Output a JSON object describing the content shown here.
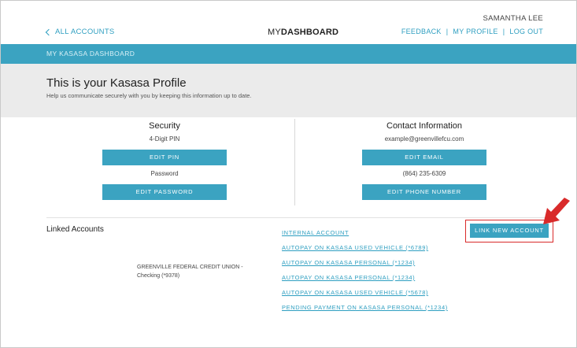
{
  "header": {
    "back_label": "ALL ACCOUNTS",
    "brand_light": "MY",
    "brand_bold": "DASHBOARD",
    "user_name": "SAMANTHA LEE",
    "links": [
      "FEEDBACK",
      "MY PROFILE",
      "LOG OUT"
    ],
    "separator": "|"
  },
  "dashbar": {
    "label": "MY KASASA DASHBOARD"
  },
  "profile": {
    "title": "This is your Kasasa Profile",
    "subtitle": "Help us communicate securely with you by keeping this information up to date."
  },
  "security": {
    "title": "Security",
    "pin_label": "4-Digit PIN",
    "edit_pin": "EDIT PIN",
    "password_label": "Password",
    "edit_password": "EDIT PASSWORD"
  },
  "contact": {
    "title": "Contact Information",
    "email": "example@greenvillefcu.com",
    "edit_email": "EDIT EMAIL",
    "phone": "(864) 235-6309",
    "edit_phone": "EDIT PHONE NUMBER"
  },
  "linked": {
    "title": "Linked Accounts",
    "bank_line1": "GREENVILLE FEDERAL CREDIT UNION -",
    "bank_line2": "Checking (*9378)",
    "accounts": [
      "INTERNAL ACCOUNT",
      "AUTOPAY ON KASASA USED VEHICLE (*6789)",
      "AUTOPAY ON KASASA PERSONAL (*1234)",
      "AUTOPAY ON KASASA PERSONAL (*1234)",
      "AUTOPAY ON KASASA USED VEHICLE (*5678)",
      "PENDING PAYMENT ON KASASA PERSONAL (*1234)"
    ],
    "link_new": "LINK NEW ACCOUNT"
  },
  "colors": {
    "accent": "#3ba3c1",
    "link": "#2f9fc1",
    "highlight": "#d92a2a",
    "header_bg": "#ebebeb"
  }
}
